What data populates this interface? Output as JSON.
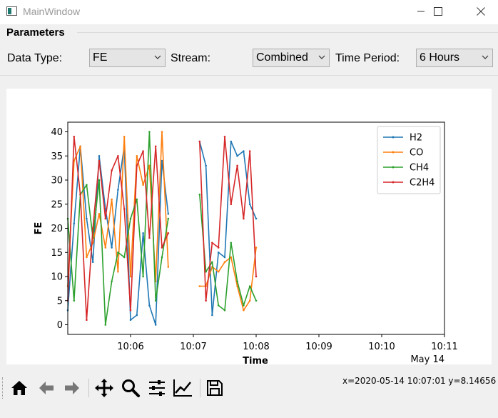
{
  "window": {
    "title": "MainWindow"
  },
  "params": {
    "group_label": "Parameters",
    "data_type_label": "Data Type:",
    "data_type_value": "FE",
    "stream_label": "Stream:",
    "stream_value": "Combined",
    "period_label": "Time Period:",
    "period_value": "6 Hours"
  },
  "status": {
    "coords": "x=2020-05-14 10:07:01 y=8.14656"
  },
  "icons": [
    "home-icon",
    "back-arrow-icon",
    "forward-arrow-icon",
    "pan-icon",
    "zoom-icon",
    "subplots-icon",
    "edit-axes-icon",
    "save-icon"
  ],
  "chart_data": {
    "type": "line",
    "xlabel": "Time",
    "ylabel": "FE",
    "x_ticks": [
      "10:06",
      "10:07",
      "10:08",
      "10:09",
      "10:10",
      "10:11"
    ],
    "x_offset_label": "May 14",
    "y_ticks": [
      0,
      5,
      10,
      15,
      20,
      25,
      30,
      35,
      40
    ],
    "xlim": [
      "2020-05-14 10:05:00",
      "2020-05-14 10:11:00"
    ],
    "ylim": [
      -2,
      42
    ],
    "legend_position": "upper right",
    "series": [
      {
        "name": "H2",
        "color": "#1f77b4",
        "segments": [
          [
            [
              "10:05:00",
              3
            ],
            [
              "10:05:06",
              21
            ],
            [
              "10:05:12",
              37
            ],
            [
              "10:05:18",
              22
            ],
            [
              "10:05:24",
              13
            ],
            [
              "10:05:30",
              35
            ],
            [
              "10:05:36",
              24
            ],
            [
              "10:05:42",
              16
            ],
            [
              "10:05:48",
              28
            ],
            [
              "10:05:54",
              37
            ],
            [
              "10:06:00",
              1
            ],
            [
              "10:06:06",
              2
            ],
            [
              "10:06:12",
              19
            ],
            [
              "10:06:18",
              4
            ],
            [
              "10:06:24",
              0
            ],
            [
              "10:06:30",
              34
            ],
            [
              "10:06:36",
              23
            ]
          ],
          [
            [
              "10:07:06",
              38
            ],
            [
              "10:07:12",
              33
            ],
            [
              "10:07:18",
              2
            ],
            [
              "10:07:24",
              15
            ],
            [
              "10:07:30",
              14
            ],
            [
              "10:07:36",
              38
            ],
            [
              "10:07:42",
              35
            ],
            [
              "10:07:48",
              36
            ],
            [
              "10:07:54",
              25
            ],
            [
              "10:08:00",
              22
            ]
          ]
        ]
      },
      {
        "name": "CO",
        "color": "#ff7f0e",
        "segments": [
          [
            [
              "10:05:00",
              8
            ],
            [
              "10:05:06",
              34
            ],
            [
              "10:05:12",
              37
            ],
            [
              "10:05:18",
              14
            ],
            [
              "10:05:24",
              17
            ],
            [
              "10:05:30",
              23
            ],
            [
              "10:05:36",
              16
            ],
            [
              "10:05:42",
              26
            ],
            [
              "10:05:48",
              11
            ],
            [
              "10:05:54",
              39
            ],
            [
              "10:06:00",
              10
            ],
            [
              "10:06:06",
              35
            ],
            [
              "10:06:12",
              29
            ],
            [
              "10:06:18",
              33
            ],
            [
              "10:06:24",
              9
            ],
            [
              "10:06:30",
              40
            ],
            [
              "10:06:36",
              12
            ]
          ],
          [
            [
              "10:07:06",
              8
            ],
            [
              "10:07:12",
              8
            ],
            [
              "10:07:18",
              12
            ],
            [
              "10:07:24",
              11
            ],
            [
              "10:07:30",
              13
            ],
            [
              "10:07:36",
              14
            ],
            [
              "10:07:42",
              8
            ],
            [
              "10:07:48",
              3
            ],
            [
              "10:07:54",
              5
            ],
            [
              "10:08:00",
              16
            ]
          ]
        ]
      },
      {
        "name": "CH4",
        "color": "#2ca02c",
        "segments": [
          [
            [
              "10:05:00",
              22
            ],
            [
              "10:05:06",
              5
            ],
            [
              "10:05:12",
              27
            ],
            [
              "10:05:18",
              29
            ],
            [
              "10:05:24",
              18
            ],
            [
              "10:05:30",
              30
            ],
            [
              "10:05:36",
              0
            ],
            [
              "10:05:42",
              9
            ],
            [
              "10:05:48",
              15
            ],
            [
              "10:05:54",
              14
            ],
            [
              "10:06:00",
              22
            ],
            [
              "10:06:06",
              26
            ],
            [
              "10:06:12",
              10
            ],
            [
              "10:06:18",
              40
            ],
            [
              "10:06:24",
              5
            ],
            [
              "10:06:30",
              14
            ],
            [
              "10:06:36",
              22
            ]
          ],
          [
            [
              "10:07:06",
              27
            ],
            [
              "10:07:12",
              11
            ],
            [
              "10:07:18",
              13
            ],
            [
              "10:07:24",
              4
            ],
            [
              "10:07:30",
              3
            ],
            [
              "10:07:36",
              17
            ],
            [
              "10:07:42",
              9
            ],
            [
              "10:07:48",
              4
            ],
            [
              "10:07:54",
              8
            ],
            [
              "10:08:00",
              5
            ]
          ]
        ]
      },
      {
        "name": "C2H4",
        "color": "#d62728",
        "segments": [
          [
            [
              "10:05:00",
              5
            ],
            [
              "10:05:06",
              39
            ],
            [
              "10:05:12",
              27
            ],
            [
              "10:05:18",
              1
            ],
            [
              "10:05:24",
              20
            ],
            [
              "10:05:30",
              34
            ],
            [
              "10:05:36",
              22
            ],
            [
              "10:05:42",
              32
            ],
            [
              "10:05:48",
              35
            ],
            [
              "10:05:54",
              24
            ],
            [
              "10:06:00",
              3
            ],
            [
              "10:06:06",
              33
            ],
            [
              "10:06:12",
              36
            ],
            [
              "10:06:18",
              18
            ],
            [
              "10:06:24",
              37
            ],
            [
              "10:06:30",
              16
            ],
            [
              "10:06:36",
              19
            ]
          ],
          [
            [
              "10:07:06",
              38
            ],
            [
              "10:07:12",
              5
            ],
            [
              "10:07:18",
              17
            ],
            [
              "10:07:24",
              16
            ],
            [
              "10:07:30",
              39
            ],
            [
              "10:07:36",
              25
            ],
            [
              "10:07:42",
              33
            ],
            [
              "10:07:48",
              22
            ],
            [
              "10:07:54",
              36
            ],
            [
              "10:08:00",
              10
            ]
          ]
        ]
      }
    ]
  }
}
